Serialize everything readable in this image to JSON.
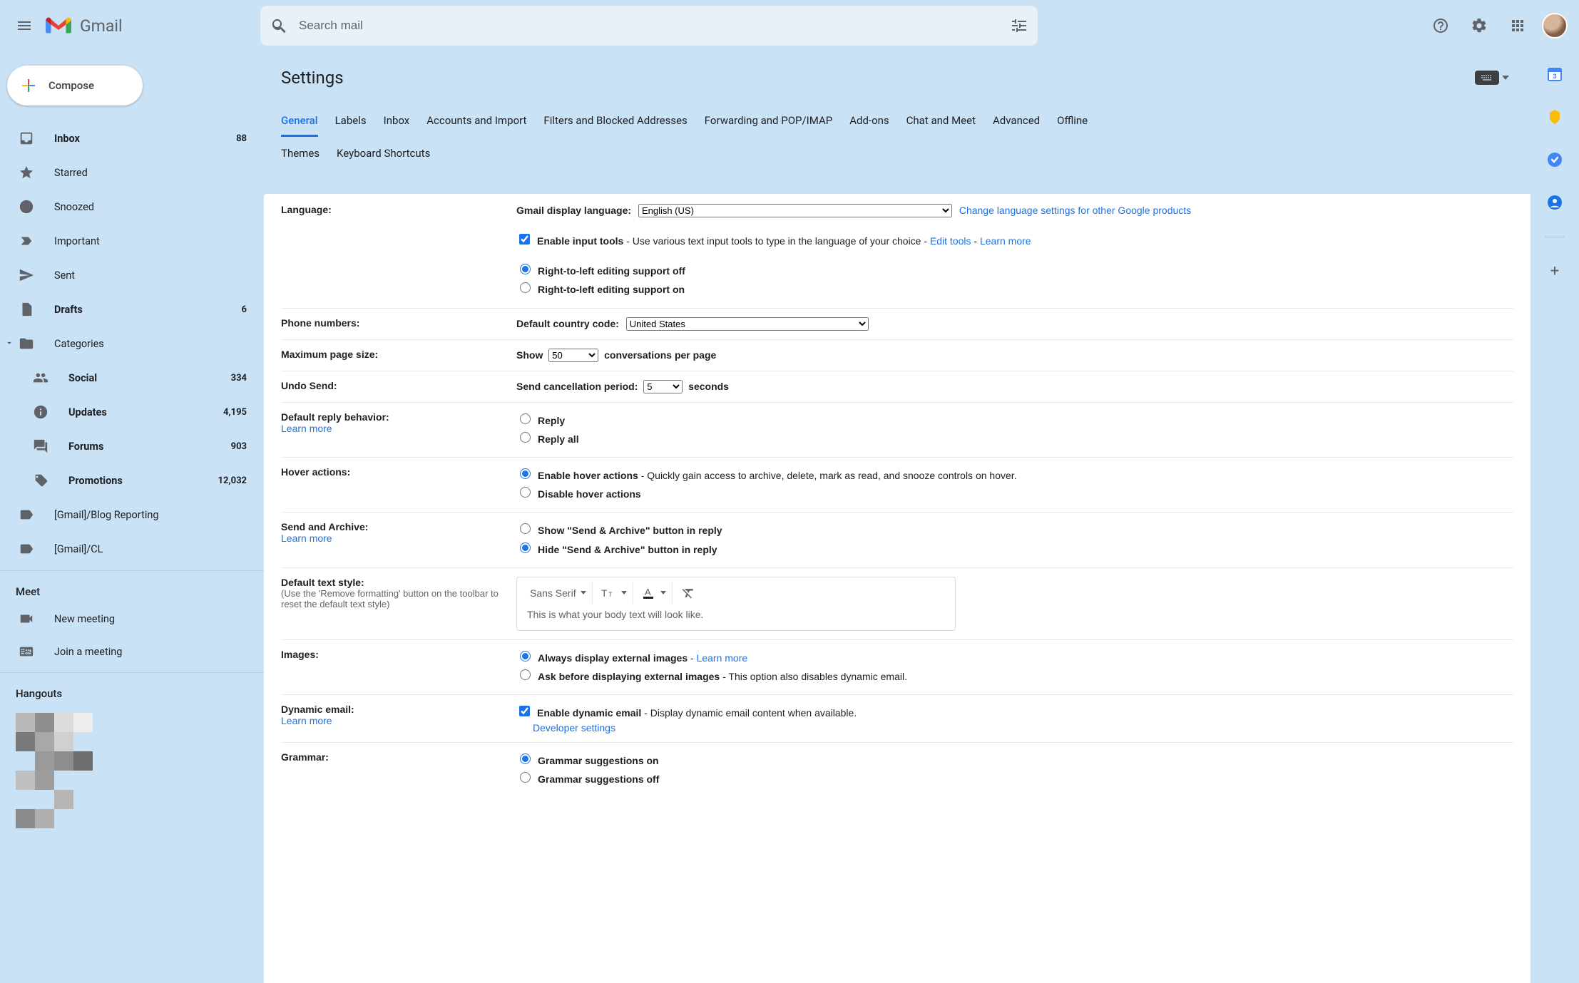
{
  "app": {
    "name": "Gmail"
  },
  "search": {
    "placeholder": "Search mail"
  },
  "compose": "Compose",
  "sidebar": {
    "items": [
      {
        "id": "inbox",
        "label": "Inbox",
        "count": "88",
        "bold": true
      },
      {
        "id": "starred",
        "label": "Starred",
        "count": "",
        "bold": false
      },
      {
        "id": "snoozed",
        "label": "Snoozed",
        "count": "",
        "bold": false
      },
      {
        "id": "important",
        "label": "Important",
        "count": "",
        "bold": false
      },
      {
        "id": "sent",
        "label": "Sent",
        "count": "",
        "bold": false
      },
      {
        "id": "drafts",
        "label": "Drafts",
        "count": "6",
        "bold": true
      },
      {
        "id": "categories",
        "label": "Categories",
        "count": "",
        "bold": false
      }
    ],
    "categories": [
      {
        "id": "social",
        "label": "Social",
        "count": "334",
        "bold": true
      },
      {
        "id": "updates",
        "label": "Updates",
        "count": "4,195",
        "bold": true
      },
      {
        "id": "forums",
        "label": "Forums",
        "count": "903",
        "bold": true
      },
      {
        "id": "promotions",
        "label": "Promotions",
        "count": "12,032",
        "bold": true
      }
    ],
    "labels": [
      {
        "id": "blogrep",
        "label": "[Gmail]/Blog Reporting"
      },
      {
        "id": "cl",
        "label": "[Gmail]/CL"
      }
    ]
  },
  "meet": {
    "header": "Meet",
    "items": [
      {
        "id": "newmeeting",
        "label": "New meeting"
      },
      {
        "id": "joinmeeting",
        "label": "Join a meeting"
      }
    ]
  },
  "hangouts": {
    "header": "Hangouts"
  },
  "page": {
    "title": "Settings"
  },
  "tabs": {
    "row1": [
      "General",
      "Labels",
      "Inbox",
      "Accounts and Import",
      "Filters and Blocked Addresses",
      "Forwarding and POP/IMAP",
      "Add-ons",
      "Chat and Meet",
      "Advanced",
      "Offline"
    ],
    "row2": [
      "Themes",
      "Keyboard Shortcuts"
    ],
    "active": "General"
  },
  "settings": {
    "language": {
      "label": "Language:",
      "display_label": "Gmail display language:",
      "selected": "English (US)",
      "change_link": "Change language settings for other Google products",
      "input_tools_label": "Enable input tools",
      "input_tools_desc": " - Use various text input tools to type in the language of your choice - ",
      "edit_tools": "Edit tools",
      "learn_more": "Learn more",
      "rtl_off": "Right-to-left editing support off",
      "rtl_on": "Right-to-left editing support on"
    },
    "phone": {
      "label": "Phone numbers:",
      "cc_label": "Default country code:",
      "cc_value": "United States"
    },
    "pagesize": {
      "label": "Maximum page size:",
      "show": "Show",
      "value": "50",
      "tail": "conversations per page"
    },
    "undo": {
      "label": "Undo Send:",
      "lead": "Send cancellation period:",
      "value": "5",
      "tail": "seconds"
    },
    "reply": {
      "label": "Default reply behavior:",
      "learn": "Learn more",
      "opt1": "Reply",
      "opt2": "Reply all"
    },
    "hover": {
      "label": "Hover actions:",
      "opt1": "Enable hover actions",
      "opt1_desc": " - Quickly gain access to archive, delete, mark as read, and snooze controls on hover.",
      "opt2": "Disable hover actions"
    },
    "sendarchive": {
      "label": "Send and Archive:",
      "learn": "Learn more",
      "opt1": "Show \"Send & Archive\" button in reply",
      "opt2": "Hide \"Send & Archive\" button in reply"
    },
    "textstyle": {
      "label": "Default text style:",
      "sub": "(Use the 'Remove formatting' button on the toolbar to reset the default text style)",
      "font": "Sans Serif",
      "preview": "This is what your body text will look like."
    },
    "images": {
      "label": "Images:",
      "opt1": "Always display external images",
      "learn": "Learn more",
      "opt2": "Ask before displaying external images",
      "opt2_desc": " - This option also disables dynamic email."
    },
    "dynamic": {
      "label": "Dynamic email:",
      "learn": "Learn more",
      "opt": "Enable dynamic email",
      "desc": " - Display dynamic email content when available.",
      "dev": "Developer settings"
    },
    "grammar": {
      "label": "Grammar:",
      "opt1": "Grammar suggestions on",
      "opt2": "Grammar suggestions off"
    }
  }
}
